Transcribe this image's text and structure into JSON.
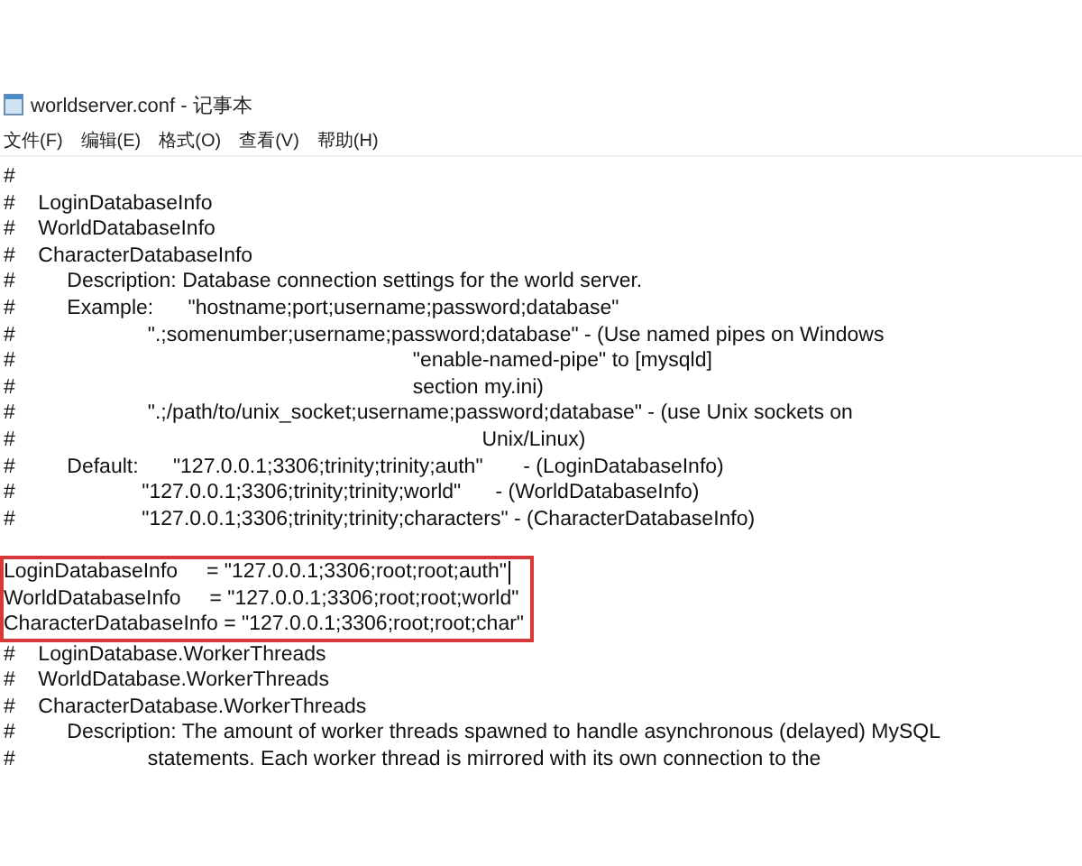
{
  "window": {
    "title": "worldserver.conf - 记事本"
  },
  "menu": [
    {
      "label": "文件(F)"
    },
    {
      "label": "编辑(E)"
    },
    {
      "label": "格式(O)"
    },
    {
      "label": "查看(V)"
    },
    {
      "label": "帮助(H)"
    }
  ],
  "blocks": [
    {
      "kind": "plain",
      "lines": [
        {
          "text": "#"
        },
        {
          "text": "#    LoginDatabaseInfo"
        },
        {
          "text": "#    WorldDatabaseInfo"
        },
        {
          "text": "#    CharacterDatabaseInfo"
        },
        {
          "text": "#         Description: Database connection settings for the world server."
        },
        {
          "text": "#         Example:      \"hostname;port;username;password;database\""
        },
        {
          "text": "#                       \".;somenumber;username;password;database\" - (Use named pipes on Windows"
        },
        {
          "text": "#                                                                     \"enable-named-pipe\" to [mysqld]"
        },
        {
          "text": "#                                                                     section my.ini)"
        },
        {
          "text": "#                       \".;/path/to/unix_socket;username;password;database\" - (use Unix sockets on"
        },
        {
          "text": "#                                                                                 Unix/Linux)"
        },
        {
          "text": "#         Default:      \"127.0.0.1;3306;trinity;trinity;auth\"       - (LoginDatabaseInfo)"
        },
        {
          "text": "#                      \"127.0.0.1;3306;trinity;trinity;world\"      - (WorldDatabaseInfo)"
        },
        {
          "text": "#                      \"127.0.0.1;3306;trinity;trinity;characters\" - (CharacterDatabaseInfo)"
        }
      ]
    },
    {
      "kind": "boxed",
      "lines": [
        {
          "text": "LoginDatabaseInfo     = \"127.0.0.1;3306;root;root;auth\"",
          "cursor": true
        },
        {
          "text": "WorldDatabaseInfo     = \"127.0.0.1;3306;root;root;world\"",
          "cursor": false
        },
        {
          "text": "CharacterDatabaseInfo = \"127.0.0.1;3306;root;root;char\"",
          "cursor": false
        }
      ]
    },
    {
      "kind": "plain",
      "lines": [
        {
          "text": "#    LoginDatabase.WorkerThreads"
        },
        {
          "text": "#    WorldDatabase.WorkerThreads"
        },
        {
          "text": "#    CharacterDatabase.WorkerThreads"
        },
        {
          "text": "#         Description: The amount of worker threads spawned to handle asynchronous (delayed) MySQL"
        },
        {
          "text": "#                       statements. Each worker thread is mirrored with its own connection to the"
        }
      ]
    }
  ]
}
